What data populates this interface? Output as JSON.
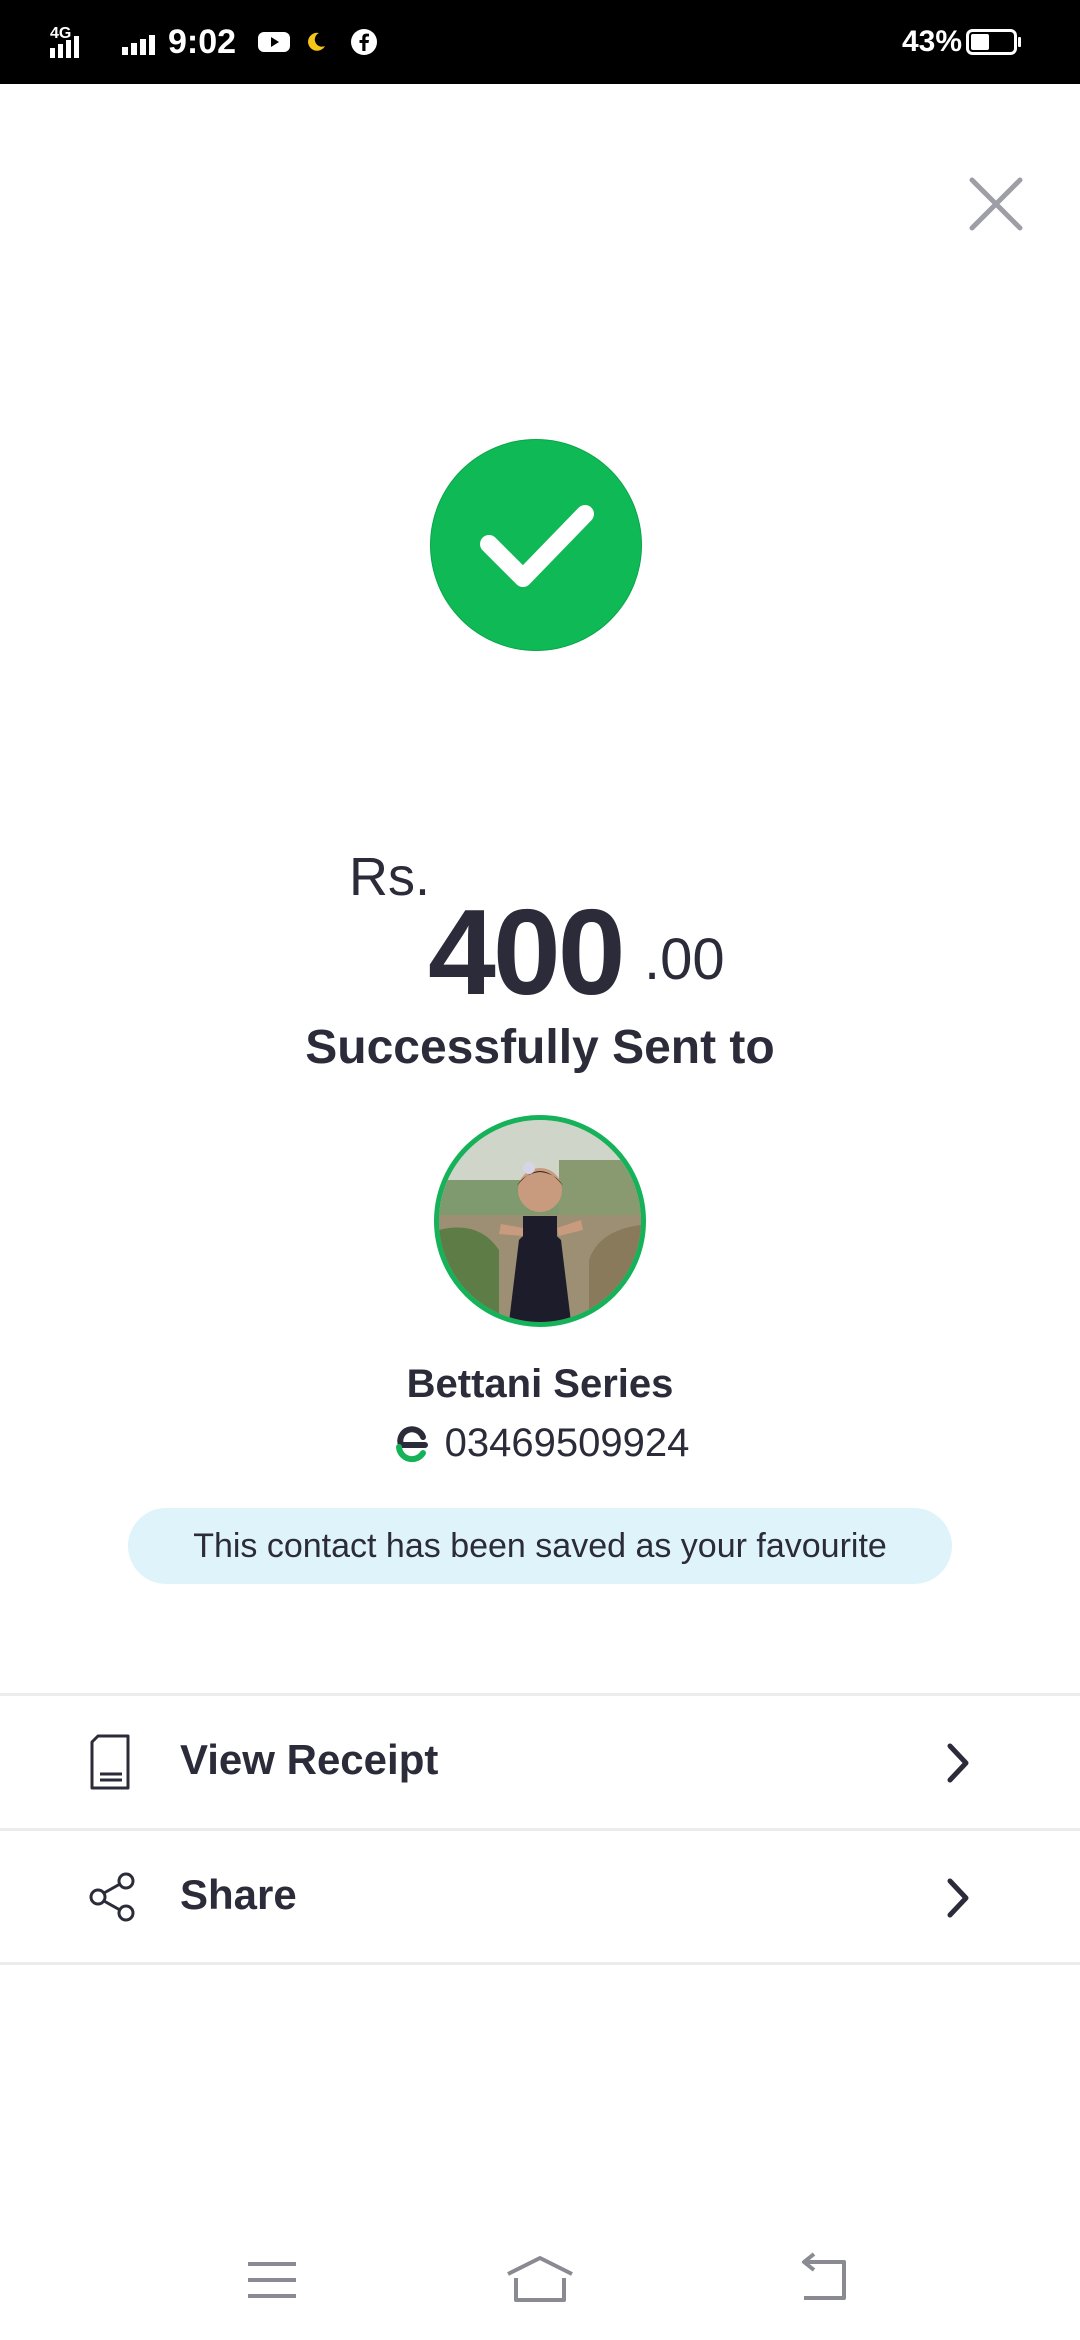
{
  "status_bar": {
    "network_type": "4G",
    "time": "9:02",
    "battery_percent": "43%",
    "battery_level": 0.43,
    "icons": [
      "signal-icon",
      "youtube-icon",
      "night-mode-icon",
      "facebook-icon",
      "battery-icon"
    ]
  },
  "close": {
    "icon": "close-icon"
  },
  "success": {
    "icon": "checkmark-icon",
    "color": "#0fb955"
  },
  "amount": {
    "currency": "Rs.",
    "major": "400",
    "minor": ".00"
  },
  "sent_to_label": "Successfully Sent to",
  "contact": {
    "name": "Bettani Series",
    "phone": "03469509924",
    "wallet_icon": "easypaisa-logo-icon",
    "avatar_ring_color": "#16b25a"
  },
  "favourite_notice": "This contact has been saved as your favourite",
  "actions": [
    {
      "label": "View Receipt",
      "icon": "receipt-icon"
    },
    {
      "label": "Share",
      "icon": "share-icon"
    }
  ],
  "nav_bar": {
    "icons": [
      "menu-icon",
      "home-icon",
      "back-icon"
    ]
  },
  "colors": {
    "accent_green": "#0fb955",
    "text_dark": "#2b2b3a",
    "banner_bg": "#dff3fb"
  }
}
